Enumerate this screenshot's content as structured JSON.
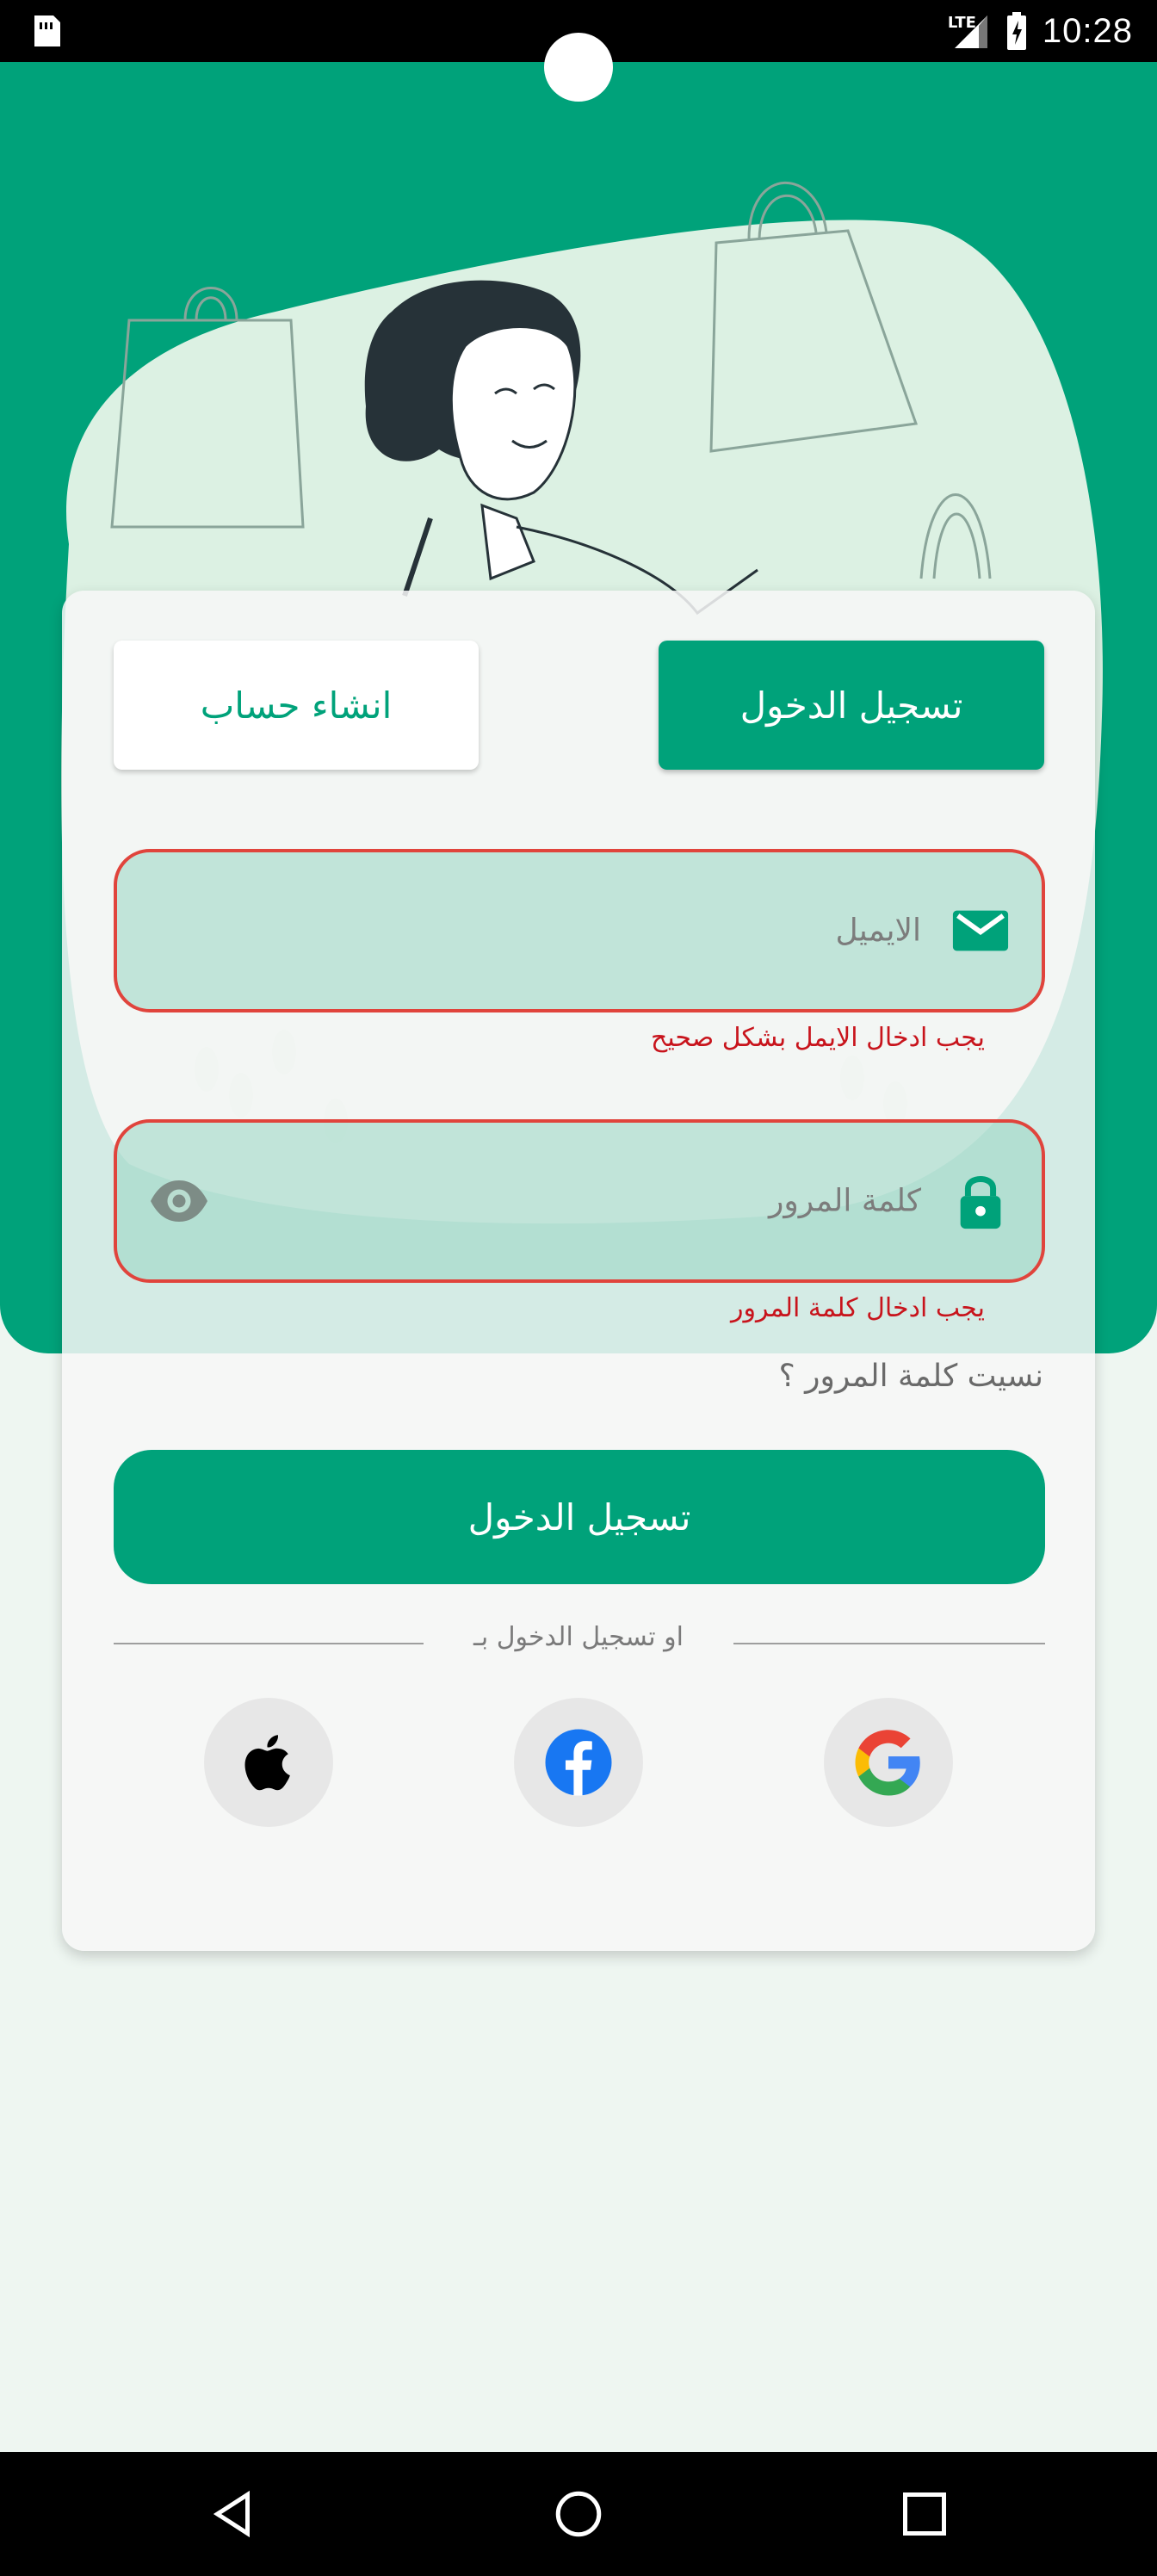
{
  "status_bar": {
    "time": "10:28",
    "network": "LTE"
  },
  "tabs": {
    "login_label": "تسجيل الدخول",
    "register_label": "انشاء حساب"
  },
  "form": {
    "email": {
      "placeholder": "الايميل",
      "value": "",
      "error": "يجب ادخال الايمل بشكل صحيح"
    },
    "password": {
      "placeholder": "كلمة المرور",
      "value": "",
      "error": "يجب ادخال كلمة المرور"
    },
    "forgot_password": "نسيت كلمة المرور ؟",
    "login_button": "تسجيل الدخول",
    "social_divider": "او تسجيل الدخول بـ"
  },
  "social": {
    "apple": "apple-icon",
    "facebook": "facebook-icon",
    "google": "google-icon"
  },
  "colors": {
    "primary": "#00a27a",
    "error": "#e0443c",
    "error_text": "#c8141c",
    "header_bg": "#00a27a",
    "card_bg": "#f7f7f7"
  }
}
